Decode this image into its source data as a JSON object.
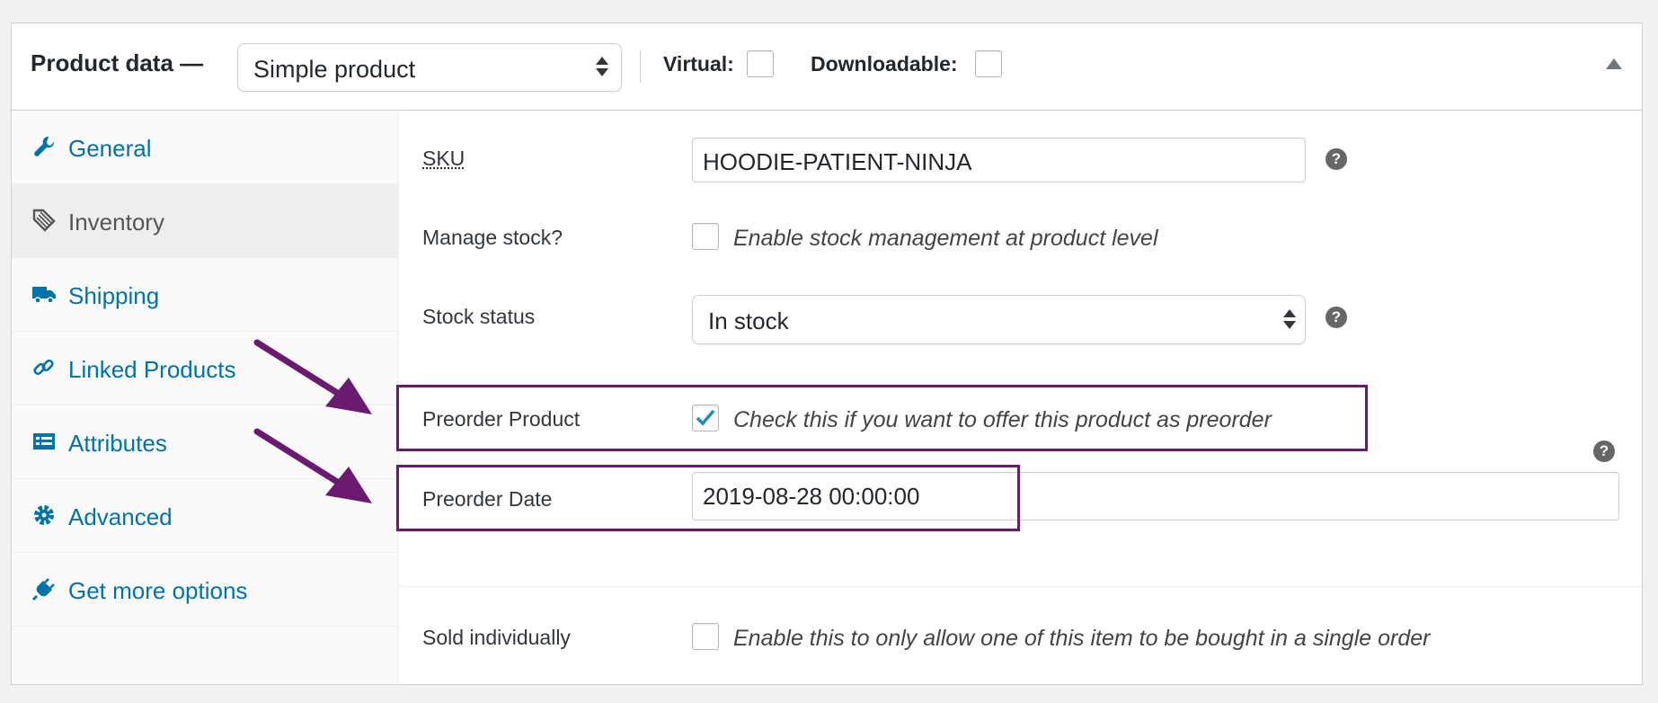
{
  "header": {
    "title": "Product data —",
    "product_type": "Simple product",
    "virtual_label": "Virtual:",
    "downloadable_label": "Downloadable:"
  },
  "sidebar": {
    "items": [
      {
        "label": "General",
        "icon": "wrench-icon",
        "active": false
      },
      {
        "label": "Inventory",
        "icon": "tag-icon",
        "active": true
      },
      {
        "label": "Shipping",
        "icon": "truck-icon",
        "active": false
      },
      {
        "label": "Linked Products",
        "icon": "link-icon",
        "active": false
      },
      {
        "label": "Attributes",
        "icon": "list-icon",
        "active": false
      },
      {
        "label": "Advanced",
        "icon": "gear-icon",
        "active": false
      },
      {
        "label": "Get more options",
        "icon": "plug-icon",
        "active": false
      }
    ]
  },
  "inventory": {
    "sku_label": "SKU",
    "sku_value": "HOODIE-PATIENT-NINJA",
    "manage_stock_label": "Manage stock?",
    "manage_stock_desc": "Enable stock management at product level",
    "manage_stock_checked": false,
    "stock_status_label": "Stock status",
    "stock_status_value": "In stock",
    "preorder_product_label": "Preorder Product",
    "preorder_product_desc": "Check this if you want to offer this product as preorder",
    "preorder_product_checked": true,
    "preorder_date_label": "Preorder Date",
    "preorder_date_value": "2019-08-28 00:00:00",
    "sold_individually_label": "Sold individually",
    "sold_individually_desc": "Enable this to only allow one of this item to be bought in a single order",
    "sold_individually_checked": false,
    "help_glyph": "?"
  },
  "colors": {
    "link": "#0073aa",
    "highlight": "#6a1b6f",
    "checkmark": "#1e8cbe"
  }
}
